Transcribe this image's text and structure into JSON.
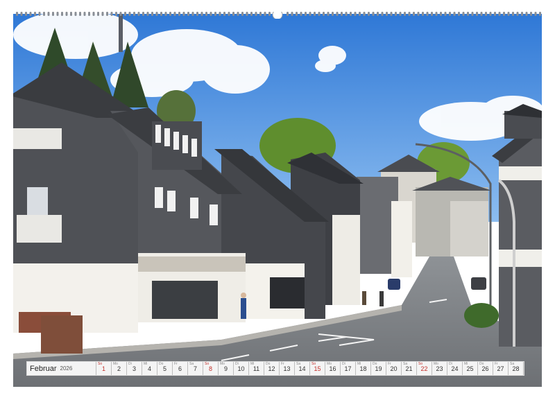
{
  "calendar": {
    "month": "Februar",
    "year": "2026",
    "days": [
      {
        "n": "1",
        "wd": "So",
        "sun": true
      },
      {
        "n": "2",
        "wd": "Mo",
        "sun": false
      },
      {
        "n": "3",
        "wd": "Di",
        "sun": false
      },
      {
        "n": "4",
        "wd": "Mi",
        "sun": false
      },
      {
        "n": "5",
        "wd": "Do",
        "sun": false
      },
      {
        "n": "6",
        "wd": "Fr",
        "sun": false
      },
      {
        "n": "7",
        "wd": "Sa",
        "sun": false
      },
      {
        "n": "8",
        "wd": "So",
        "sun": true
      },
      {
        "n": "9",
        "wd": "Mo",
        "sun": false
      },
      {
        "n": "10",
        "wd": "Di",
        "sun": false
      },
      {
        "n": "11",
        "wd": "Mi",
        "sun": false
      },
      {
        "n": "12",
        "wd": "Do",
        "sun": false
      },
      {
        "n": "13",
        "wd": "Fr",
        "sun": false
      },
      {
        "n": "14",
        "wd": "Sa",
        "sun": false
      },
      {
        "n": "15",
        "wd": "So",
        "sun": true
      },
      {
        "n": "16",
        "wd": "Mo",
        "sun": false
      },
      {
        "n": "17",
        "wd": "Di",
        "sun": false
      },
      {
        "n": "18",
        "wd": "Mi",
        "sun": false
      },
      {
        "n": "19",
        "wd": "Do",
        "sun": false
      },
      {
        "n": "20",
        "wd": "Fr",
        "sun": false
      },
      {
        "n": "21",
        "wd": "Sa",
        "sun": false
      },
      {
        "n": "22",
        "wd": "So",
        "sun": true
      },
      {
        "n": "23",
        "wd": "Mo",
        "sun": false
      },
      {
        "n": "24",
        "wd": "Di",
        "sun": false
      },
      {
        "n": "25",
        "wd": "Mi",
        "sun": false
      },
      {
        "n": "26",
        "wd": "Do",
        "sun": false
      },
      {
        "n": "27",
        "wd": "Fr",
        "sun": false
      },
      {
        "n": "28",
        "wd": "Sa",
        "sun": false
      }
    ]
  },
  "colors": {
    "sky": "#3f86db",
    "slate": "#4f5156",
    "sunday": "#c4302b"
  }
}
